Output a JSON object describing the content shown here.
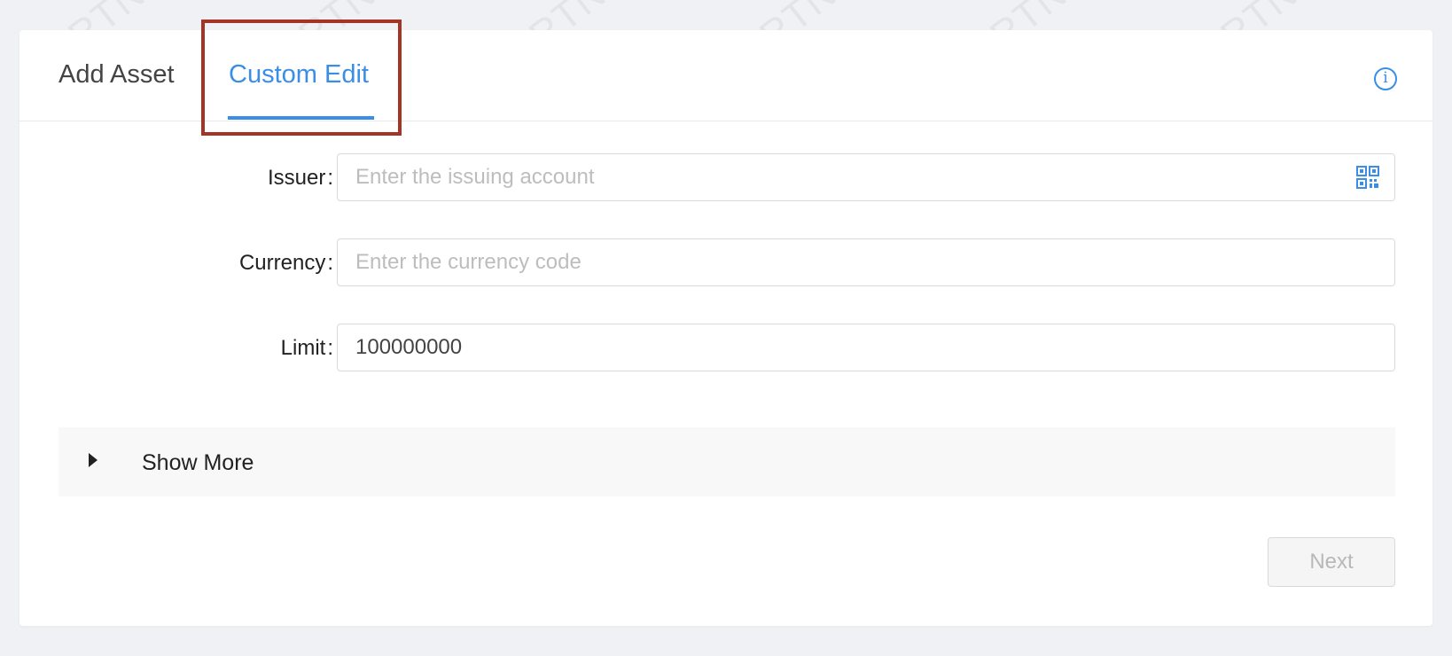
{
  "watermark": {
    "text": "RTNE"
  },
  "tabs": [
    {
      "label": "Add Asset",
      "active": false
    },
    {
      "label": "Custom Edit",
      "active": true
    }
  ],
  "form": {
    "issuer": {
      "label": "Issuer",
      "separator": ":",
      "placeholder": "Enter the issuing account",
      "value": ""
    },
    "currency": {
      "label": "Currency",
      "separator": ":",
      "placeholder": "Enter the currency code",
      "value": ""
    },
    "limit": {
      "label": "Limit",
      "separator": ":",
      "placeholder": "",
      "value": "100000000"
    }
  },
  "show_more": {
    "label": "Show More",
    "expanded": false
  },
  "actions": {
    "next_label": "Next",
    "next_disabled": true
  },
  "icons": {
    "info": "info-circle-icon",
    "qr": "qr-code-icon",
    "caret": "caret-right-icon"
  },
  "colors": {
    "accent": "#3a8ee6",
    "highlight": "#a23526",
    "background": "#f0f1f4"
  }
}
